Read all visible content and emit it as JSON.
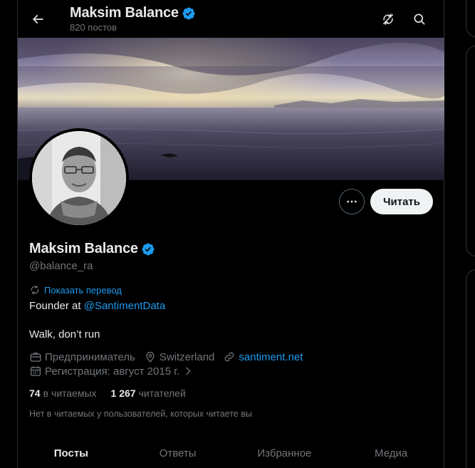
{
  "header": {
    "title": "Maksim Balance",
    "post_count": "820 постов"
  },
  "profile": {
    "name": "Maksim Balance",
    "handle": "@balance_ra",
    "translate_link": "Показать перевод",
    "bio_line1_prefix": "Founder at ",
    "bio_mention": "@SantimentData",
    "bio_line2": "Walk, don’t run",
    "category": "Предприниматель",
    "location": "Switzerland",
    "website": "santiment.net",
    "joined": "Регистрация: август 2015 г.",
    "following_count": "74",
    "following_label": "в читаемых",
    "followers_count": "1 267",
    "followers_label": "читателей",
    "followed_note": "Нет в читаемых у пользователей, которых читаете вы"
  },
  "actions": {
    "follow_label": "Читать"
  },
  "tabs": [
    {
      "label": "Посты",
      "active": true
    },
    {
      "label": "Ответы",
      "active": false
    },
    {
      "label": "Избранное",
      "active": false
    },
    {
      "label": "Медиа",
      "active": false
    }
  ],
  "colors": {
    "background": "#000000",
    "text": "#e7e9ea",
    "muted": "#71767b",
    "accent": "#1d9bf0",
    "verified": "#1d9bf0"
  }
}
